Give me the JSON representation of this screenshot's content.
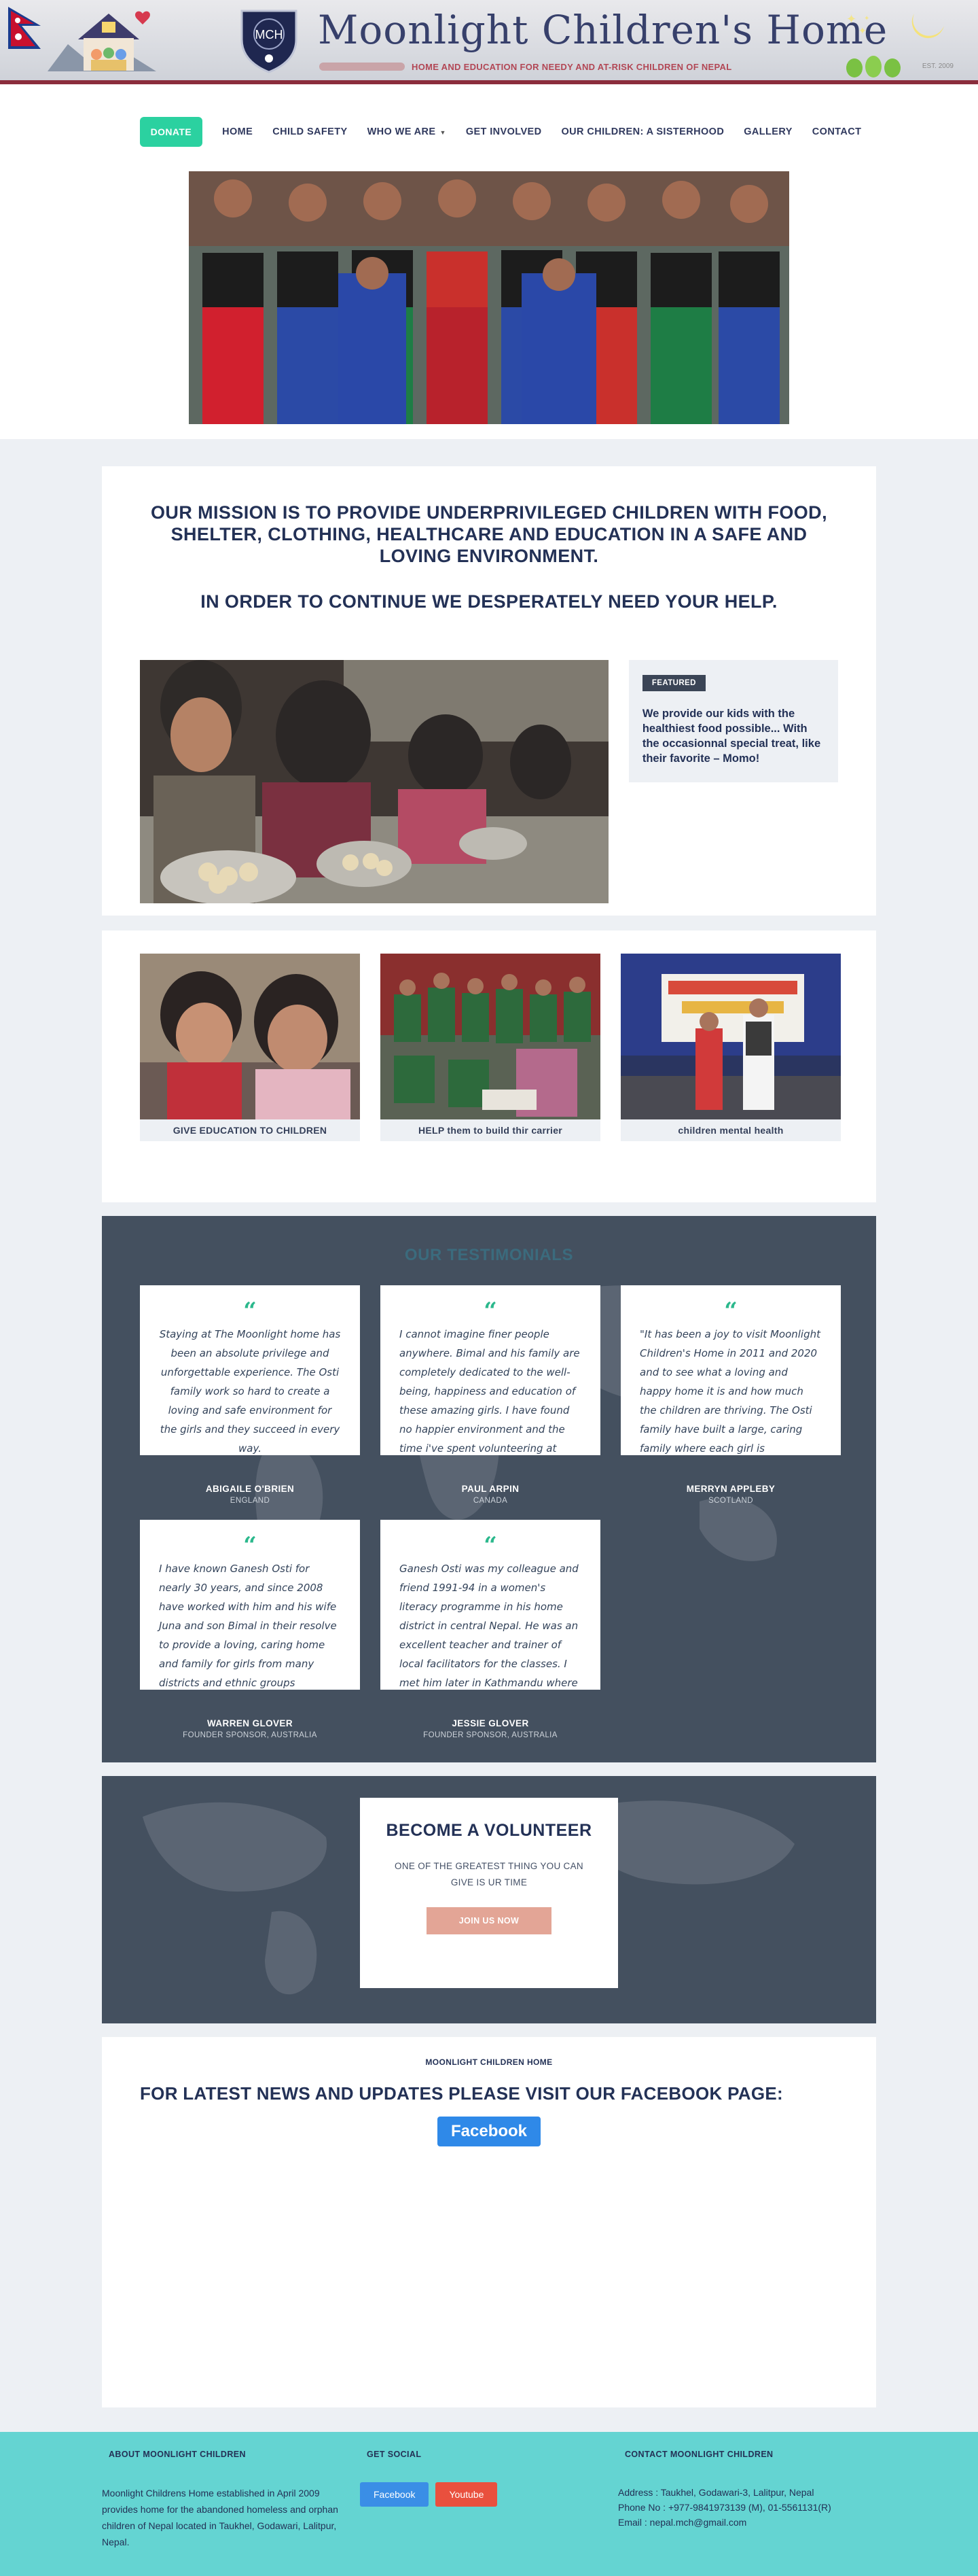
{
  "header": {
    "title": "Moonlight Children's Home",
    "tagline": "HOME AND EDUCATION FOR NEEDY AND AT-RISK CHILDREN OF NEPAL",
    "crest_text": "MCH",
    "est": "EST. 2009"
  },
  "nav": {
    "donate": "DONATE",
    "items": [
      "HOME",
      "CHILD SAFETY",
      "WHO WE ARE",
      "GET INVOLVED",
      "OUR CHILDREN: A SISTERHOOD",
      "GALLERY",
      "CONTACT"
    ],
    "dropdown_icon": "caret-down-icon"
  },
  "mission": {
    "heading": "OUR MISSION IS TO PROVIDE UNDERPRIVILEGED CHILDREN WITH FOOD, SHELTER, CLOTHING, HEALTHCARE AND EDUCATION IN A SAFE AND LOVING ENVIRONMENT.",
    "subheading": "IN ORDER TO CONTINUE WE DESPERATELY NEED YOUR HELP.",
    "featured_badge": "FEATURED",
    "featured_text": "We provide our kids with the healthiest food possible... With the occasionnal special treat, like their favorite – Momo!"
  },
  "programs": [
    {
      "caption": "GIVE EDUCATION TO CHILDREN"
    },
    {
      "caption": "HELP them to build thir carrier"
    },
    {
      "caption": "children mental health"
    }
  ],
  "testimonials": {
    "title": "OUR TESTIMONIALS",
    "items": [
      {
        "text": "Staying at The Moonlight home has been an absolute privilege and unforgettable experience. The Osti family work so hard to create a loving and safe environment for the girls and they succeed in every way.",
        "author": "ABIGAILE O'BRIEN",
        "location": "ENGLAND"
      },
      {
        "text": "I cannot imagine finer people anywhere. Bimal and his family are completely dedicated to the well-being, happiness and education of these amazing girls. I have found no happier environment and the time i've spent volunteering at",
        "author": "PAUL ARPIN",
        "location": "CANADA"
      },
      {
        "text": "\"It has been a joy to visit Moonlight Children's Home in 2011 and 2020 and to see what a loving and happy home it is and how much the children are thriving. The Osti family have built a large, caring family where each girl is",
        "author": "MERRYN APPLEBY",
        "location": "SCOTLAND"
      },
      {
        "text": "I have known Ganesh Osti for nearly 30 years, and since 2008 have worked with him and his wife Juna and son Bimal in their resolve to provide a loving, caring home and family for girls from many districts and ethnic groups",
        "author": "WARREN GLOVER",
        "location": "FOUNDER SPONSOR, AUSTRALIA"
      },
      {
        "text": "Ganesh Osti was my colleague and friend 1991-94 in a women's literacy programme in his home district in central Nepal. He was an excellent teacher and trainer of local facilitators for the classes. I met him later in Kathmandu where he",
        "author": "JESSIE GLOVER",
        "location": "FOUNDER SPONSOR, AUSTRALIA"
      }
    ]
  },
  "volunteer": {
    "title": "BECOME A VOLUNTEER",
    "subtitle": "ONE OF THE GREATEST THING YOU CAN GIVE IS UR TIME",
    "button": "JOIN US NOW"
  },
  "news": {
    "small_title": "MOONLIGHT CHILDREN HOME",
    "heading": "FOR LATEST NEWS AND UPDATES PLEASE VISIT OUR FACEBOOK PAGE:",
    "button": "Facebook"
  },
  "footer": {
    "about_title": "ABOUT MOONLIGHT CHILDREN",
    "about_text": "Moonlight Childrens Home established in April 2009 provides home for the abandoned homeless and orphan children of Nepal located in Taukhel, Godawari, Lalitpur, Nepal.",
    "social_title": "GET SOCIAL",
    "facebook": "Facebook",
    "youtube": "Youtube",
    "contact_title": "CONTACT MOONLIGHT CHILDREN",
    "address": "Address : Taukhel, Godawari-3, Lalitpur, Nepal",
    "phone": "Phone No : +977-9841973139 (M), 01-5561131(R)",
    "email": "Email : nepal.mch@gmail.com"
  },
  "colors": {
    "accent": "#2bd1a0",
    "navy": "#233156",
    "dark_section": "#44505f",
    "footer": "#64d4d2",
    "banner_border": "#8b2d3c"
  }
}
